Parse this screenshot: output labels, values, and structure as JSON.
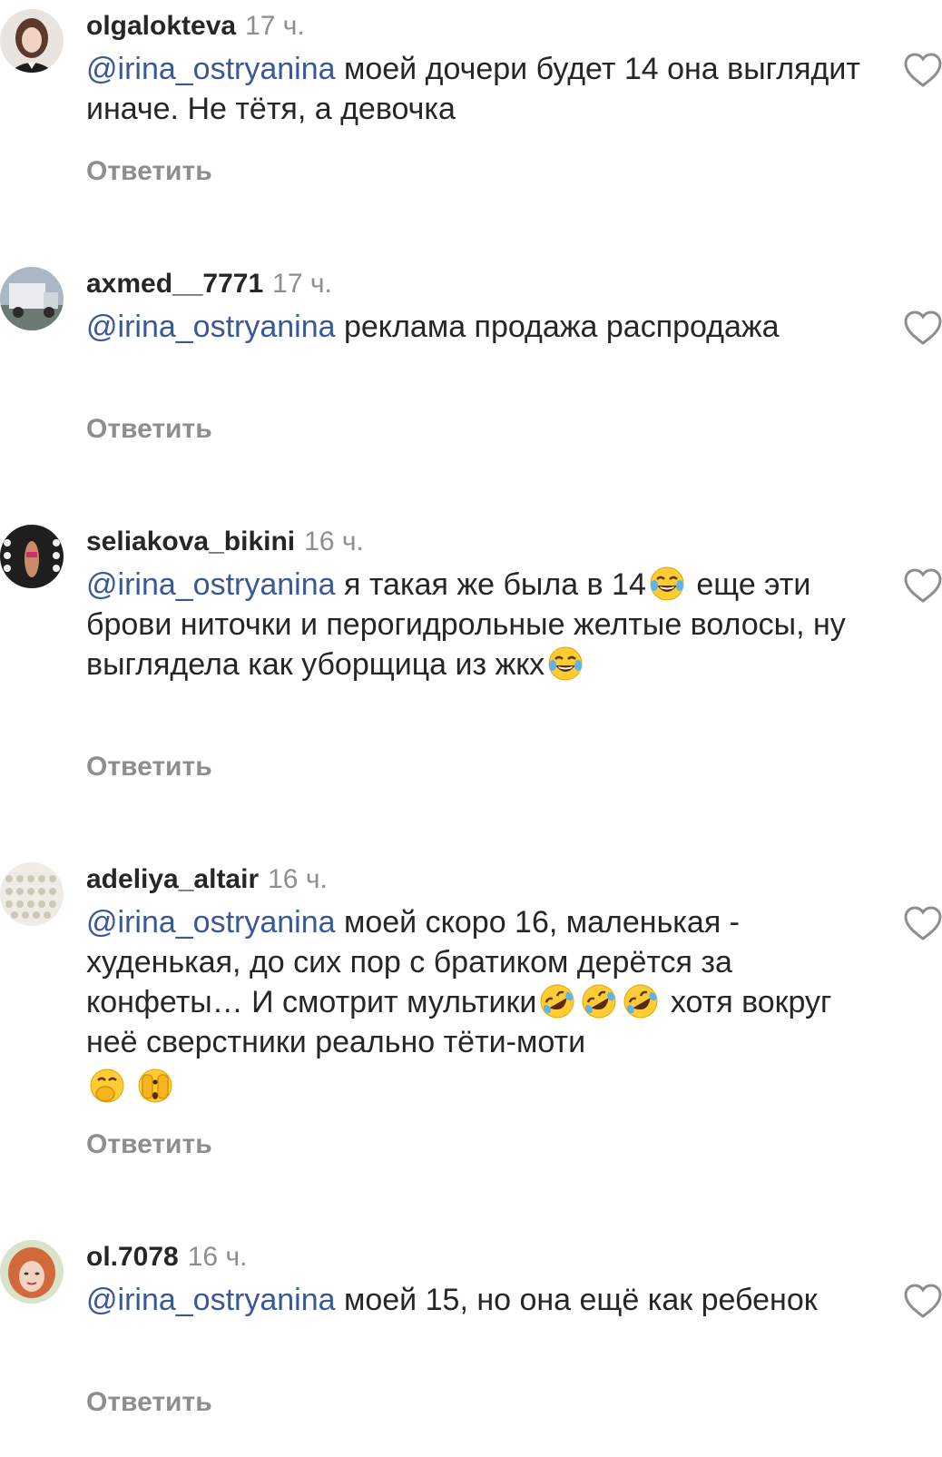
{
  "comments": [
    {
      "username": "olgalokteva",
      "time": "17 ч.",
      "mention": "@irina_ostryanina",
      "text": " моей дочери будет 14 она выглядит иначе. Не тётя, а девочка",
      "reply": "Ответить"
    },
    {
      "username": "axmed__7771",
      "time": "17 ч.",
      "mention": "@irina_ostryanina",
      "text": " реклама продажа распродажа",
      "reply": "Ответить"
    },
    {
      "username": "seliakova_bikini",
      "time": "16 ч.",
      "mention": "@irina_ostryanina",
      "text_a": " я такая же была в 14",
      "text_b": " еще эти брови ниточки и перогидрольные желтые волосы, ну выглядела как уборщица из жкх",
      "reply": "Ответить"
    },
    {
      "username": "adeliya_altair",
      "time": "16 ч.",
      "mention": "@irina_ostryanina",
      "text_a": " моей скоро 16, маленькая - худенькая, до сих пор с братиком дерётся за конфеты… И смотрит мультики",
      "text_b": " хотя вокруг неё сверстники реально тёти-моти",
      "reply": "Ответить"
    },
    {
      "username": "ol.7078",
      "time": "16 ч.",
      "mention": "@irina_ostryanina",
      "text": " моей 15, но она ещё как ребенок",
      "reply": "Ответить"
    }
  ],
  "icons": {
    "like": "heart-outline-icon",
    "laugh": "face-with-tears-of-joy-icon",
    "rofl": "rolling-on-the-floor-laughing-icon",
    "hand_over_mouth": "face-with-hand-over-mouth-icon",
    "peeking": "face-with-peeking-eye-icon"
  },
  "colors": {
    "mention": "#385898",
    "secondary": "#8e8e8e",
    "text": "#262626"
  }
}
